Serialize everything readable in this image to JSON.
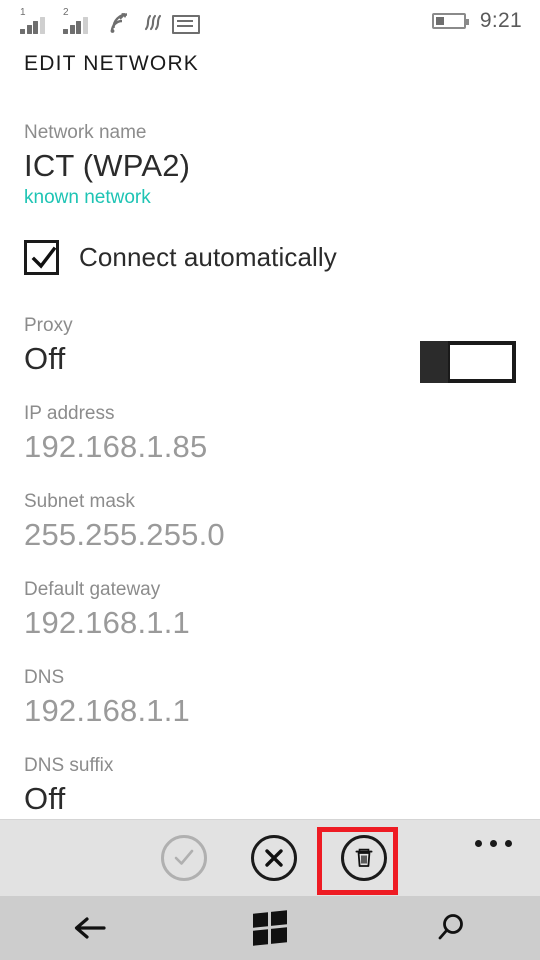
{
  "status_bar": {
    "sim1_label": "1",
    "sim2_label": "2",
    "wifi_icon": "wifi-icon",
    "vibrate_icon": "vibrate-icon",
    "sim_icon": "sim-card-icon",
    "battery_icon": "battery-icon",
    "time": "9:21"
  },
  "page": {
    "title": "EDIT NETWORK"
  },
  "fields": {
    "network_name": {
      "label": "Network name",
      "value": "ICT (WPA2)",
      "sub": "known network",
      "sub_color": "#1ec4b4"
    },
    "connect_automatically": {
      "label": "Connect automatically",
      "checked": true
    },
    "proxy": {
      "label": "Proxy",
      "value": "Off",
      "toggle_state": "off"
    },
    "ip_address": {
      "label": "IP address",
      "value": "192.168.1.85"
    },
    "subnet_mask": {
      "label": "Subnet mask",
      "value": "255.255.255.0"
    },
    "default_gateway": {
      "label": "Default gateway",
      "value": "192.168.1.1"
    },
    "dns": {
      "label": "DNS",
      "value": "192.168.1.1"
    },
    "dns_suffix": {
      "label": "DNS suffix",
      "value": "Off"
    }
  },
  "app_bar": {
    "accept": {
      "icon": "check-icon",
      "enabled": false
    },
    "cancel": {
      "icon": "close-icon",
      "enabled": true
    },
    "delete": {
      "icon": "trash-icon",
      "enabled": true,
      "highlighted": true
    },
    "more": {
      "icon": "ellipsis-icon"
    }
  },
  "annotation": {
    "color": "#ee1b23",
    "target": "delete-button"
  },
  "nav_bar": {
    "back": "back-arrow-icon",
    "start": "windows-logo-icon",
    "search": "search-icon"
  }
}
